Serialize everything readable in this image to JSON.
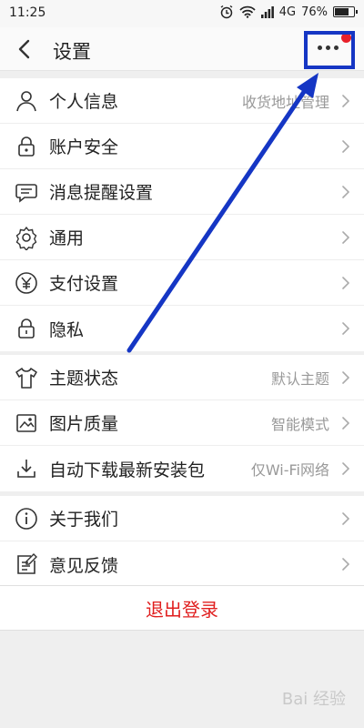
{
  "status_bar": {
    "time": "11:25",
    "network": "4G",
    "battery": "76%",
    "battery_level": 0.76
  },
  "header": {
    "title": "设置"
  },
  "groups": [
    {
      "items": [
        {
          "label": "个人信息",
          "value": "收货地址管理"
        },
        {
          "label": "账户安全",
          "value": ""
        },
        {
          "label": "消息提醒设置",
          "value": ""
        },
        {
          "label": "通用",
          "value": ""
        },
        {
          "label": "支付设置",
          "value": ""
        },
        {
          "label": "隐私",
          "value": ""
        }
      ]
    },
    {
      "items": [
        {
          "label": "主题状态",
          "value": "默认主题"
        },
        {
          "label": "图片质量",
          "value": "智能模式"
        },
        {
          "label": "自动下载最新安装包",
          "value": "仅Wi-Fi网络"
        }
      ]
    },
    {
      "items": [
        {
          "label": "关于我们",
          "value": ""
        },
        {
          "label": "意见反馈",
          "value": ""
        }
      ]
    }
  ],
  "logout": {
    "label": "退出登录"
  },
  "watermark": "Bai 经验",
  "colors": {
    "highlight": "#1536c4",
    "logout": "#e01f1f",
    "badge": "#e8202a"
  }
}
